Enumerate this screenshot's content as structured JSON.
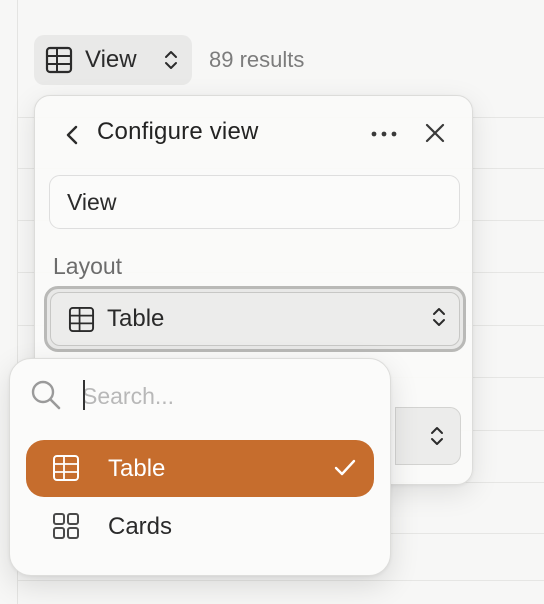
{
  "toolbar": {
    "view_button": {
      "label": "View",
      "icon": "table-icon"
    },
    "results_count": "89 results"
  },
  "configure_view": {
    "title": "Configure view",
    "name_value": "View",
    "layout_label": "Layout",
    "layout_value": "Table"
  },
  "layout_menu": {
    "search_placeholder": "Search...",
    "search_value": "",
    "options": [
      {
        "label": "Table",
        "icon": "table-icon",
        "selected": true
      },
      {
        "label": "Cards",
        "icon": "grid-icon",
        "selected": false
      }
    ]
  },
  "colors": {
    "accent": "#c66d2d",
    "background": "#f7f7f6",
    "panel": "#fafaf9",
    "muted_text": "#7c7c7c"
  }
}
